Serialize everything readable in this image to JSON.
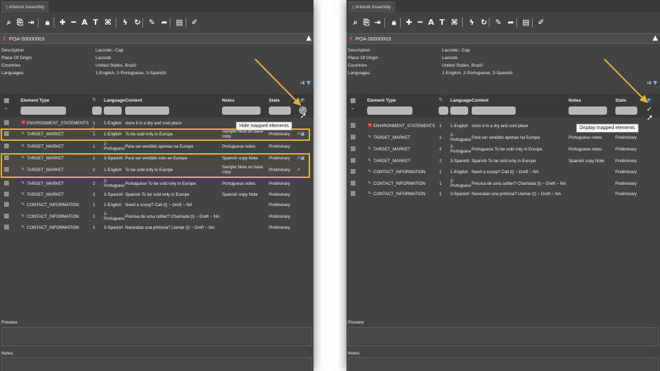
{
  "tab_title": "Artwork Assembly",
  "document_title": "POA-00000003",
  "metadata": [
    {
      "label": "Description",
      "value": "Lacoste:- Cap"
    },
    {
      "label": "Place Of Origin",
      "value": "Lacoste"
    },
    {
      "label": "Countries",
      "value": "United States, Brazil"
    },
    {
      "label": "Languages",
      "value": "1-English, 2-Portuguese, 3-Spanish"
    }
  ],
  "columns": {
    "element_type": "Element Type",
    "language": "Language",
    "content": "Content",
    "notes": "Notes",
    "state": "State"
  },
  "toolbar_icons": [
    "search-icon",
    "attach-icon",
    "export-icon",
    "lock-icon",
    "add-icon",
    "remove-icon",
    "text-format-icon",
    "text-format-alt-icon",
    "hierarchy-icon",
    "flash-icon",
    "refresh-icon",
    "edit-icon",
    "send-icon",
    "clipboard-icon",
    "note-icon"
  ],
  "left_panel": {
    "tooltip": "Hide mapped elements",
    "rows": [
      {
        "type": "ENVIRONMENT_STATEMENTS",
        "icon": "environment",
        "seq": "1",
        "language": "1-English",
        "content": "store it in a dry and cool place",
        "notes": "",
        "state": ""
      },
      {
        "type": "TARGET_MARKET",
        "icon": "edit",
        "seq": "1",
        "language": "1-English",
        "content": "To be sold only in Europe",
        "notes": "Sample Note on base copy",
        "state": "Preliminary"
      },
      {
        "type": "TARGET_MARKET",
        "icon": "edit",
        "seq": "1",
        "language": "2-Portuguese",
        "content": "Para ser vendido apenas na Europa",
        "notes": "Portuguese notes",
        "state": "Preliminary"
      },
      {
        "type": "TARGET_MARKET",
        "icon": "edit",
        "seq": "1",
        "language": "3-Spanish",
        "content": "Para ser vendido solo en Europa",
        "notes": "Spanish copy Note",
        "state": "Preliminary"
      },
      {
        "type": "TARGET_MARKET",
        "icon": "edit",
        "seq": "2",
        "language": "1-English",
        "content": "To be sold only in Europe",
        "notes": "Sample Note on base copy",
        "state": "Preliminary"
      },
      {
        "type": "TARGET_MARKET",
        "icon": "edit",
        "seq": "2",
        "language": "2-Portuguese",
        "content": "Portuguese To be sold only in Europe",
        "notes": "Portuguese notes",
        "state": "Preliminary"
      },
      {
        "type": "TARGET_MARKET",
        "icon": "edit",
        "seq": "2",
        "language": "3-Spanish",
        "content": "Spanish To be sold only in Europe",
        "notes": "Spanish copy Note",
        "state": "Preliminary"
      },
      {
        "type": "CONTACT_INFORMATION",
        "icon": "edit",
        "seq": "1",
        "language": "1-English",
        "content": "Need a scoop? Call (t) ~ Dreft ~ NA",
        "notes": "",
        "state": "Preliminary"
      },
      {
        "type": "CONTACT_INFORMATION",
        "icon": "edit",
        "seq": "1",
        "language": "2-Portuguese",
        "content": "Precisa de uma colher? Chamada (t) ~ Dreft ~ NA",
        "notes": "",
        "state": "Preliminary"
      },
      {
        "type": "CONTACT_INFORMATION",
        "icon": "edit",
        "seq": "1",
        "language": "3-Spanish",
        "content": "Necesitas una primicia? Llamar (t) ~ Dreft ~ NA",
        "notes": "",
        "state": "Preliminary"
      }
    ]
  },
  "right_panel": {
    "tooltip": "Display mapped elements",
    "rows": [
      {
        "type": "ENVIRONMENT_STATEMENTS",
        "icon": "environment",
        "seq": "1",
        "language": "1-English",
        "content": "store it in a dry and cool place",
        "notes": "",
        "state": ""
      },
      {
        "type": "TARGET_MARKET",
        "icon": "edit",
        "seq": "1",
        "language": "2-Portuguese",
        "content": "Para ser vendido apenas na Europa",
        "notes": "Portuguese notes",
        "state": "Preliminary"
      },
      {
        "type": "TARGET_MARKET",
        "icon": "edit",
        "seq": "2",
        "language": "2-Portuguese",
        "content": "Portuguese To be sold only in Europe",
        "notes": "Portuguese notes",
        "state": "Preliminary"
      },
      {
        "type": "TARGET_MARKET",
        "icon": "edit",
        "seq": "2",
        "language": "3-Spanish",
        "content": "Spanish To be sold only in Europe",
        "notes": "Spanish copy Note",
        "state": "Preliminary"
      },
      {
        "type": "CONTACT_INFORMATION",
        "icon": "edit",
        "seq": "1",
        "language": "1-English",
        "content": "Need a scoop? Call (t) ~ Dreft ~ NA",
        "notes": "",
        "state": "Preliminary"
      },
      {
        "type": "CONTACT_INFORMATION",
        "icon": "edit",
        "seq": "1",
        "language": "2-Portuguese",
        "content": "Precisa de uma colher? Chamada (t) ~ Dreft ~ NA",
        "notes": "",
        "state": "Preliminary"
      },
      {
        "type": "CONTACT_INFORMATION",
        "icon": "edit",
        "seq": "1",
        "language": "3-Spanish",
        "content": "Necesitas una primicia? Llamar (t) ~ Dreft ~ NA",
        "notes": "",
        "state": "Preliminary"
      }
    ]
  },
  "sections": {
    "preview": "Preview",
    "notes": "Notes"
  },
  "colors": {
    "panel_bg": "#434343",
    "highlight": "#e8b23a",
    "environment_icon": "#cc3a3a"
  }
}
